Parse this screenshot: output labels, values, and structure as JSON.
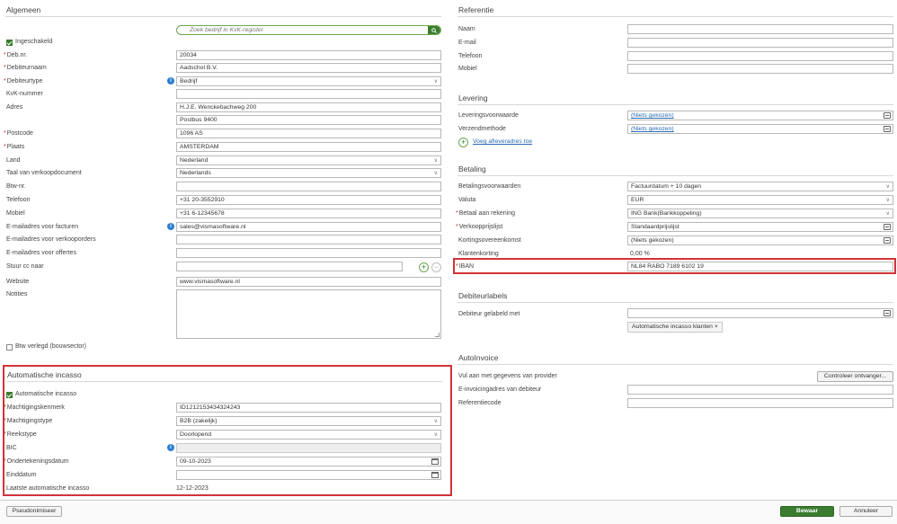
{
  "algemeen": {
    "title": "Algemeen",
    "search_placeholder": "Zoek bedrijf in KvK-register",
    "ingeschakeld": "Ingeschakeld",
    "fields": [
      {
        "label": "Déb.nr.",
        "value": "20034",
        "required": true
      },
      {
        "label": "Debiteurnaam",
        "value": "Aadschol B.V.",
        "required": true
      },
      {
        "label": "Debiteurtype",
        "value": "Bedrijf",
        "required": true
      },
      {
        "label": "KvK-nummer",
        "value": ""
      },
      {
        "label": "Adres",
        "value": "H.J.E. Wenckebachweg 200"
      },
      {
        "label": "",
        "value": "Postbus 9400"
      },
      {
        "label": "Postcode",
        "value": "1096 AS",
        "required": true
      },
      {
        "label": "Plaats",
        "value": "AMSTERDAM",
        "required": true
      },
      {
        "label": "Land",
        "value": "Nederland"
      },
      {
        "label": "Taal van verkoopdocument",
        "value": "Nederlands"
      },
      {
        "label": "Btw-nr.",
        "value": ""
      },
      {
        "label": "Telefoon",
        "value": "+31 20-3552910"
      },
      {
        "label": "Mobiel",
        "value": "+31 6-12345678"
      },
      {
        "label": "E-mailadres voor facturen",
        "value": "sales@vismasoftware.nl"
      },
      {
        "label": "E-mailadres voor verkooporders",
        "value": ""
      },
      {
        "label": "E-mailadres voor offertes",
        "value": ""
      },
      {
        "label": "Stuur cc naar",
        "value": ""
      },
      {
        "label": "Website",
        "value": "www.vismasoftware.nl"
      },
      {
        "label": "Notities",
        "value": ""
      }
    ],
    "btw_verlegd": "Btw verlegd (bouwsector)"
  },
  "incasso": {
    "title": "Automatische incasso",
    "checkbox": "Automatische incasso",
    "fields": [
      {
        "label": "Machtigingskenmerk",
        "value": "ID1212153434324243",
        "required": true
      },
      {
        "label": "Machtigingstype",
        "value": "B2B (zakelijk)",
        "required": true
      },
      {
        "label": "Reekstype",
        "value": "Doorlopend",
        "required": true
      },
      {
        "label": "BIC",
        "value": ""
      },
      {
        "label": "Ondertekeningsdatum",
        "value": "09-10-2023",
        "required": true
      },
      {
        "label": "Einddatum",
        "value": ""
      },
      {
        "label": "Laatste automatische incasso",
        "value": "12-12-2023"
      }
    ]
  },
  "referentie": {
    "title": "Referentie",
    "fields": [
      {
        "label": "Naam",
        "value": ""
      },
      {
        "label": "E-mail",
        "value": ""
      },
      {
        "label": "Telefoon",
        "value": ""
      },
      {
        "label": "Mobiel",
        "value": ""
      }
    ]
  },
  "levering": {
    "title": "Levering",
    "fields": [
      {
        "label": "Leveringsvoorwaarde",
        "value": "(Niets gekozen)"
      },
      {
        "label": "Verzendmethode",
        "value": "(Niets gekozen)"
      }
    ],
    "add_address": "Voeg afleveradres toe"
  },
  "betaling": {
    "title": "Betaling",
    "fields": [
      {
        "label": "Betalingsvoorwaarden",
        "value": "Factuurdatum + 10 dagen"
      },
      {
        "label": "Valuta",
        "value": "EUR"
      },
      {
        "label": "Betaal aan rekening",
        "value": "ING Bank(Bankkoppeling)",
        "required": true
      },
      {
        "label": "Verkoopprijslijst",
        "value": "Standaardprijslijst",
        "required": true
      },
      {
        "label": "Kortingsovereenkomst",
        "value": "(Niets gekozen)"
      },
      {
        "label": "Klantenkorting",
        "value": "0,00 %"
      },
      {
        "label": "IBAN",
        "value": "NL84 RABO 7189 6102 19",
        "required": true
      }
    ]
  },
  "debiteurlabels": {
    "title": "Debiteurlabels",
    "label": "Debiteur gelabeld met",
    "tag": "Automatische incasso klanten",
    "tag_remove": "×"
  },
  "autoinvoice": {
    "title": "AutoInvoice",
    "fields": [
      {
        "label": "Vul aan met gegevens van provider",
        "value": ""
      },
      {
        "label": "E-invoicingadres van debiteur",
        "value": ""
      },
      {
        "label": "Referentiecode",
        "value": ""
      }
    ],
    "controleer_button": "Controleer ontvanger..."
  },
  "footer": {
    "pseudonimiseer": "Pseudonimiseer",
    "bewaar": "Bewaar",
    "annuleer": "Annuleer"
  },
  "colors": {
    "accent_green": "#3a7d2e",
    "highlight_red": "#d23339",
    "link_blue": "#2a6bb0"
  }
}
